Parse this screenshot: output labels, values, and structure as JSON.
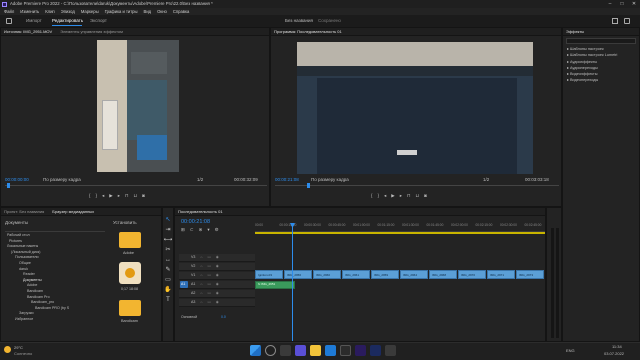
{
  "window": {
    "title": "Adobe Premiere Pro 2022 - C:\\Пользователи\\daruk\\Документы\\Adobe\\Premiere Pro\\22.0\\Без названия *"
  },
  "menu": [
    "Файл",
    "Изменить",
    "Клип",
    "Эпизод",
    "Маркеры",
    "Графика и титры",
    "Вид",
    "Окно",
    "Справка"
  ],
  "workspace": {
    "tabs": [
      "Импорт",
      "Редактировать",
      "Экспорт"
    ],
    "active": 1,
    "project_name": "Без названия",
    "status": "Сохранено"
  },
  "source": {
    "title": "Источник: IMG_2951.MOV",
    "other_tab": "Элементы управления эффектом",
    "timecode": "00:00:00:00",
    "fit": "По размеру кадра",
    "ratio": "1/2",
    "duration": "00:00:32:09"
  },
  "program": {
    "title": "Программа: Последовательность 01",
    "timecode": "00:00:21:08",
    "fit": "По размеру кадра",
    "ratio": "1/2",
    "duration": "00:03:03:18"
  },
  "effects": {
    "title": "Эффекты",
    "items": [
      "Шаблоны настроек",
      "Шаблоны настроек Lumetri",
      "Аудиоэффекты",
      "Аудиопереходы",
      "Видеоэффекты",
      "Видеопереходы"
    ]
  },
  "project": {
    "tabs": [
      "Проект: Без названия",
      "Браузер медиаданных"
    ],
    "drive": "Документы",
    "tree": [
      "Рабочий стол",
      "Pictures",
      "Локальные пакеты",
      "(Локальный диск)",
      "Пользователи",
      "Общие",
      "daruk",
      "Reader",
      "Документы",
      "Adobe",
      "Bandicam",
      "Bandicam Pro",
      "Bandicam_pro",
      "Bandicam PRO (by S",
      "Загрузки",
      "Избранное"
    ],
    "filter": "Установить",
    "files": [
      "Adobe",
      "Bandicam",
      "Bandicam"
    ],
    "file_meta": "0;17 18:08"
  },
  "timeline": {
    "title": "Последовательность 01",
    "timecode": "00:00:21:08",
    "ruler": [
      "00:00",
      "00:00:15:00",
      "00:00:30:00",
      "00:00:45:00",
      "00:01:00:00",
      "00:01:15:00",
      "00:01:30:00",
      "00:01:45:00",
      "00:02:00:00",
      "00:02:15:00",
      "00:02:30:00",
      "00:02:45:00"
    ],
    "tracks": [
      "V3",
      "V2",
      "V1",
      "A1",
      "A2",
      "A3"
    ],
    "src_v": "V1",
    "src_a": "A1",
    "mix": "Основной",
    "mix_val": "0.0",
    "clips_video": [
      "Ignition-03",
      "IMG_2956",
      "IMG_2960",
      "IMG_2961",
      "IMG_2959",
      "IMG_2964",
      "IMG_2968",
      "IMG_2970",
      "IMG_2971",
      "IMG_2973"
    ],
    "clip_audio": "fx IMG_2951"
  },
  "taskbar": {
    "temp": "29°C",
    "weather": "Солнечно",
    "lang": "ENG",
    "time": "11:34",
    "date": "03.07.2022"
  },
  "colors": {
    "accent": "#2d8ceb",
    "clip": "#5b9fd6",
    "audio": "#3a9a5c"
  }
}
